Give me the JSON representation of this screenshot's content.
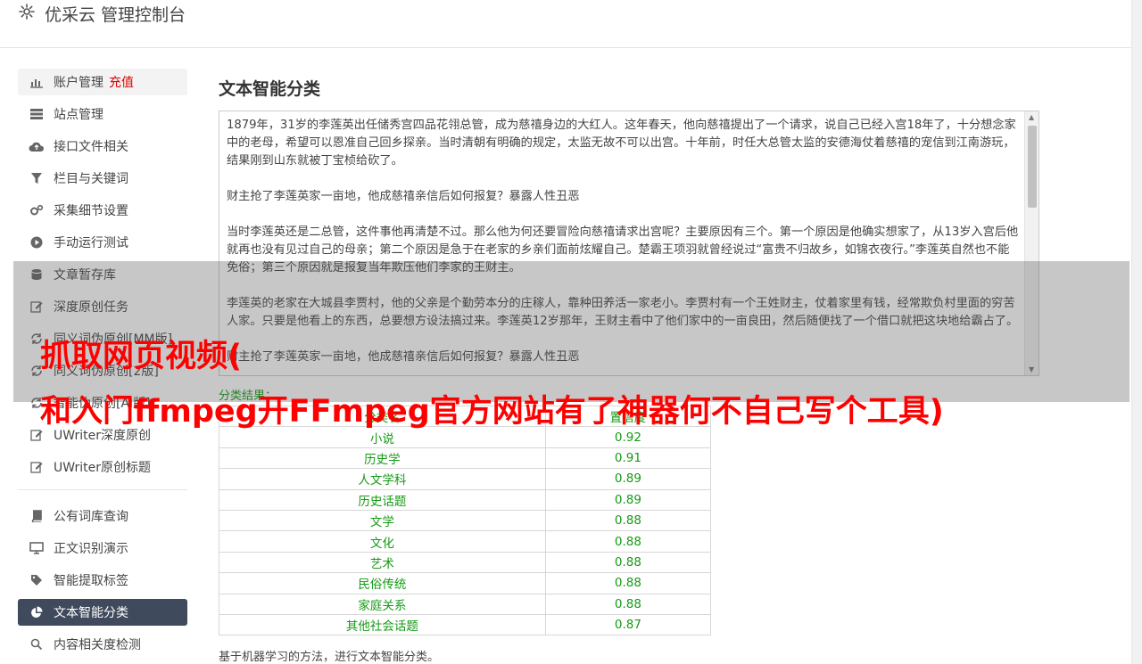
{
  "header": {
    "title": "优采云 管理控制台",
    "icon": "gear-icon"
  },
  "sidebar": {
    "group1": [
      {
        "label": "账户管理",
        "extra": "充值",
        "icon": "bar-chart-icon"
      },
      {
        "label": "站点管理",
        "icon": "server-icon"
      },
      {
        "label": "接口文件相关",
        "icon": "cloud-upload-icon"
      },
      {
        "label": "栏目与关键词",
        "icon": "filter-icon"
      },
      {
        "label": "采集细节设置",
        "icon": "gears-icon"
      },
      {
        "label": "手动运行测试",
        "icon": "play-circle-icon"
      },
      {
        "label": "文章暂存库",
        "icon": "database-icon"
      },
      {
        "label": "深度原创任务",
        "icon": "edit-icon"
      },
      {
        "label": "同义词伪原创[MM版]",
        "icon": "refresh-icon"
      },
      {
        "label": "同义词伪原创[2版]",
        "icon": "refresh-icon"
      },
      {
        "label": "智能伪原创[AI版]",
        "icon": "refresh-icon"
      },
      {
        "label": "UWriter深度原创",
        "icon": "edit-icon"
      },
      {
        "label": "UWriter原创标题",
        "icon": "edit-icon"
      }
    ],
    "group2": [
      {
        "label": "公有词库查询",
        "icon": "book-icon"
      },
      {
        "label": "正文识别演示",
        "icon": "monitor-icon"
      },
      {
        "label": "智能提取标签",
        "icon": "tag-icon"
      },
      {
        "label": "文本智能分类",
        "icon": "pie-chart-icon",
        "active": true
      },
      {
        "label": "内容相关度检测",
        "icon": "search-icon"
      }
    ]
  },
  "main": {
    "title": "文本智能分类",
    "text_paragraphs": [
      "1879年，31岁的李莲英出任储秀宫四品花翎总管，成为慈禧身边的大红人。这年春天，他向慈禧提出了一个请求，说自己已经入宫18年了，十分想念家中的老母，希望可以恩准自己回乡探亲。当时清朝有明确的规定，太监无故不可以出宫。十年前，时任大总管太监的安德海仗着慈禧的宠信到江南游玩，结果刚到山东就被丁宝桢给砍了。",
      "财主抢了李莲英家一亩地，他成慈禧亲信后如何报复？暴露人性丑恶",
      "当时李莲英还是二总管，这件事他再清楚不过。那么他为何还要冒险向慈禧请求出宫呢？主要原因有三个。第一个原因是他确实想家了，从13岁入宫后他就再也没有见过自己的母亲；第二个原因是急于在老家的乡亲们面前炫耀自己。楚霸王项羽就曾经说过“富贵不归故乡，如锦衣夜行。”李莲英自然也不能免俗；第三个原因就是报复当年欺压他们李家的王财主。",
      "李莲英的老家在大城县李贾村，他的父亲是个勤劳本分的庄稼人，靠种田养活一家老小。李贾村有一个王姓财主，仗着家里有钱，经常欺负村里面的穷苦人家。只要是他看上的东西，总要想方设法搞过来。李莲英12岁那年，王财主看中了他们家中的一亩良田，然后随便找了一个借口就把这块地给霸占了。",
      "财主抢了李莲英家一亩地，他成慈禧亲信后如何报复？暴露人性丑恶"
    ],
    "result_label": "分类结果：",
    "table": {
      "headers": [
        "分类名",
        "置信度"
      ],
      "rows": [
        [
          "小说",
          "0.92"
        ],
        [
          "历史学",
          "0.91"
        ],
        [
          "人文学科",
          "0.89"
        ],
        [
          "历史话题",
          "0.89"
        ],
        [
          "文学",
          "0.88"
        ],
        [
          "文化",
          "0.88"
        ],
        [
          "艺术",
          "0.88"
        ],
        [
          "民俗传统",
          "0.88"
        ],
        [
          "家庭关系",
          "0.88"
        ],
        [
          "其他社会话题",
          "0.87"
        ]
      ]
    },
    "footnote": "基于机器学习的方法，进行文本智能分类。"
  },
  "banner": {
    "line1": "抓取网页视频(",
    "line2": "和入门ffmpeg开FFmpeg官方网站有了神器何不自己写个工具)"
  },
  "colors": {
    "accent_active": "#3f4a5c",
    "result_green": "#159a15",
    "banner_red": "#ff0000"
  }
}
